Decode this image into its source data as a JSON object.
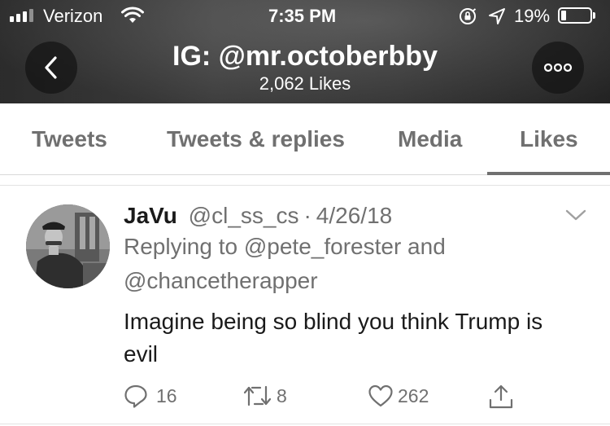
{
  "status_bar": {
    "carrier": "Verizon",
    "time": "7:35 PM",
    "battery_percent": "19%",
    "battery_level": 0.19
  },
  "header": {
    "title": "IG: @mr.octoberbby",
    "subtitle": "2,062 Likes"
  },
  "tabs": [
    {
      "label": "Tweets",
      "active": false
    },
    {
      "label": "Tweets & replies",
      "active": false
    },
    {
      "label": "Media",
      "active": false
    },
    {
      "label": "Likes",
      "active": true
    }
  ],
  "tweet": {
    "author_name": "JaVu",
    "handle": "@cl_ss_cs",
    "separator": "·",
    "date": "4/26/18",
    "reply_context_line1": "Replying to @pete_forester and",
    "reply_context_line2": "@chancetherapper",
    "text_line1": "Imagine being so blind you think Trump is",
    "text_line2": "evil",
    "actions": {
      "replies": "16",
      "retweets": "8",
      "likes": "262"
    }
  },
  "colors": {
    "header_bg": "#454545",
    "muted_text": "#707070",
    "primary_text": "#1a1a1a",
    "divider": "#e3e3e3"
  },
  "icons": [
    "signal-icon",
    "wifi-icon",
    "rotation-lock-icon",
    "location-icon",
    "battery-icon",
    "back-arrow-icon",
    "more-dots-icon",
    "chevron-down-icon",
    "reply-icon",
    "retweet-icon",
    "like-icon",
    "share-icon"
  ]
}
